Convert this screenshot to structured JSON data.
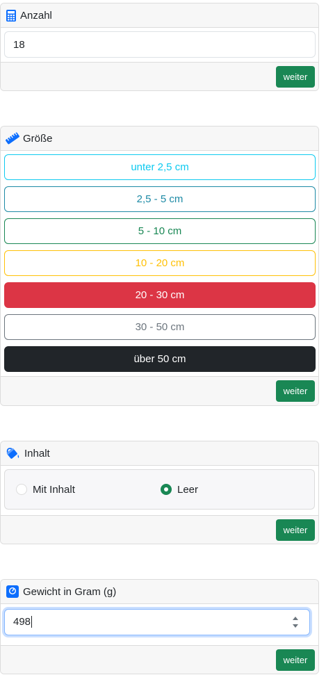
{
  "anzahl": {
    "title": "Anzahl",
    "value": "18",
    "next_label": "weiter"
  },
  "groesse": {
    "title": "Größe",
    "options": [
      {
        "label": "unter 2,5 cm",
        "color": "#0dcaf0",
        "style": "outline"
      },
      {
        "label": "2,5 - 5 cm",
        "color": "#1d8aa5",
        "style": "outline"
      },
      {
        "label": "5 - 10 cm",
        "color": "#198754",
        "style": "outline"
      },
      {
        "label": "10 - 20 cm",
        "color": "#ffc107",
        "style": "outline"
      },
      {
        "label": "20 - 30 cm",
        "color": "#dc3545",
        "style": "solid",
        "selected": true
      },
      {
        "label": "30 - 50 cm",
        "color": "#6c757d",
        "style": "outline"
      },
      {
        "label": "über 50 cm",
        "color": "#212529",
        "style": "solid"
      }
    ],
    "next_label": "weiter"
  },
  "inhalt": {
    "title": "Inhalt",
    "options": [
      {
        "label": "Mit Inhalt",
        "checked": false
      },
      {
        "label": "Leer",
        "checked": true
      }
    ],
    "next_label": "weiter"
  },
  "gewicht": {
    "title": "Gewicht in Gram (g)",
    "value": "498",
    "next_label": "weiter"
  },
  "colors": {
    "accent": "#198754",
    "icon_blue": "#0d6efd"
  }
}
